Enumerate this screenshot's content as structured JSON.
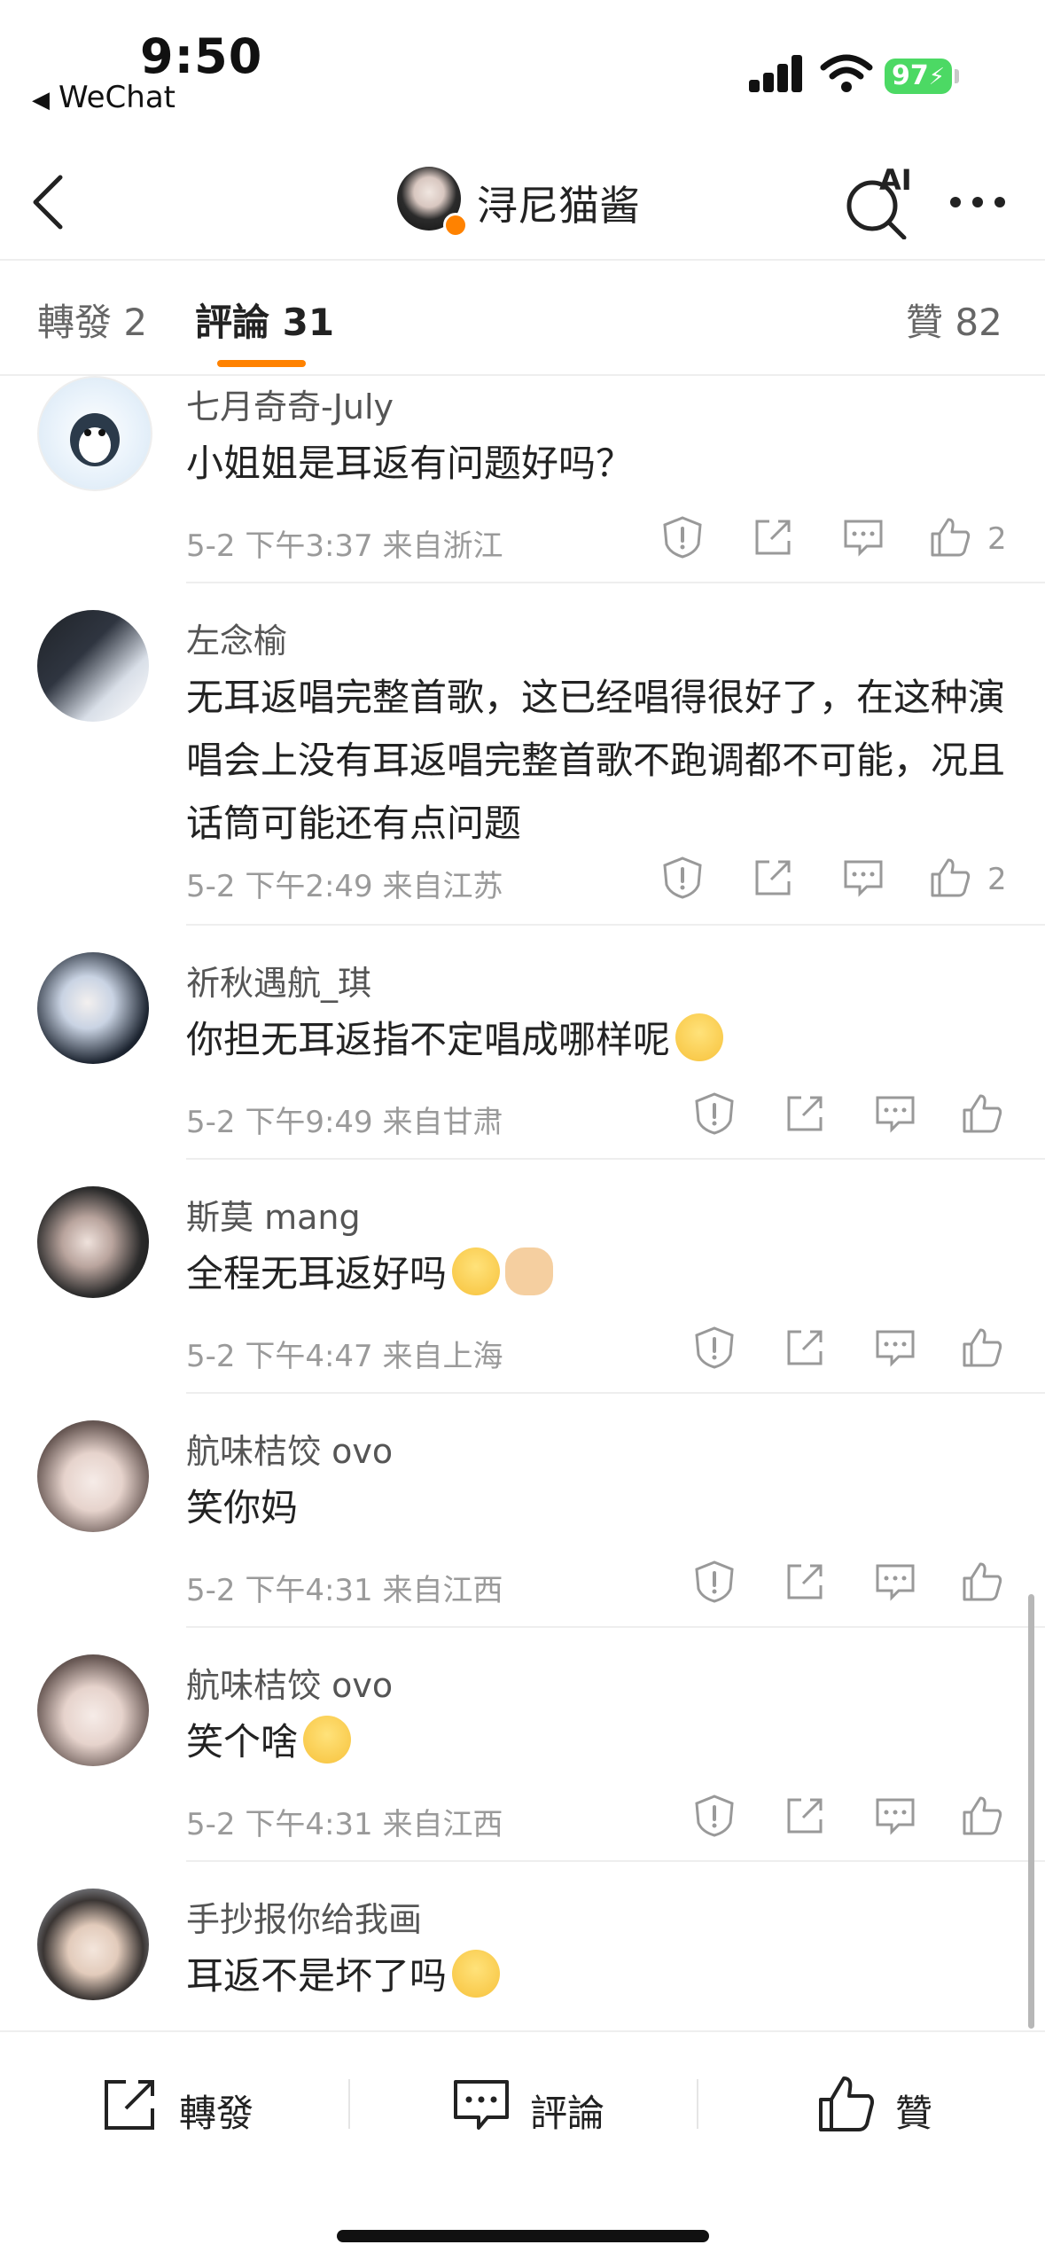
{
  "status_bar": {
    "time": "9:50",
    "back_app": "WeChat",
    "battery": "97"
  },
  "nav": {
    "title": "浔尼猫酱",
    "ai_label": "AI"
  },
  "tabs": {
    "repost_label": "轉發",
    "repost_count": "2",
    "comment_label": "評論",
    "comment_count": "31",
    "like_label": "贊",
    "like_count": "82"
  },
  "comments": [
    {
      "user": "七月奇奇-July",
      "text": "小姐姐是耳返有问题好吗？",
      "meta": "5-2 下午3:37 来自浙江",
      "likes": "2"
    },
    {
      "user": "左念榆",
      "text": "无耳返唱完整首歌，这已经唱得很好了，在这种演唱会上没有耳返唱完整首歌不跑调都不可能，况且话筒可能还有点问题",
      "meta": "5-2 下午2:49 来自江苏",
      "likes": "2"
    },
    {
      "user": "祈秋遇航_琪",
      "text": "你担无耳返指不定唱成哪样呢",
      "meta": "5-2 下午9:49 来自甘肃",
      "likes": ""
    },
    {
      "user": "斯莫 mang",
      "text": "全程无耳返好吗",
      "meta": "5-2 下午4:47 来自上海",
      "likes": ""
    },
    {
      "user": "航味桔饺 ovo",
      "text": "笑你妈",
      "meta": "5-2 下午4:31 来自江西",
      "likes": ""
    },
    {
      "user": "航味桔饺 ovo",
      "text": "笑个啥",
      "meta": "5-2 下午4:31 来自江西",
      "likes": ""
    },
    {
      "user": "手抄报你给我画",
      "text": "耳返不是坏了吗",
      "meta": "",
      "likes": ""
    }
  ],
  "bottom_bar": {
    "repost": "轉發",
    "comment": "評論",
    "like": "贊"
  },
  "colors": {
    "accent": "#ff8200",
    "battery": "#4cd964",
    "meta_text": "#9a9a9a"
  }
}
